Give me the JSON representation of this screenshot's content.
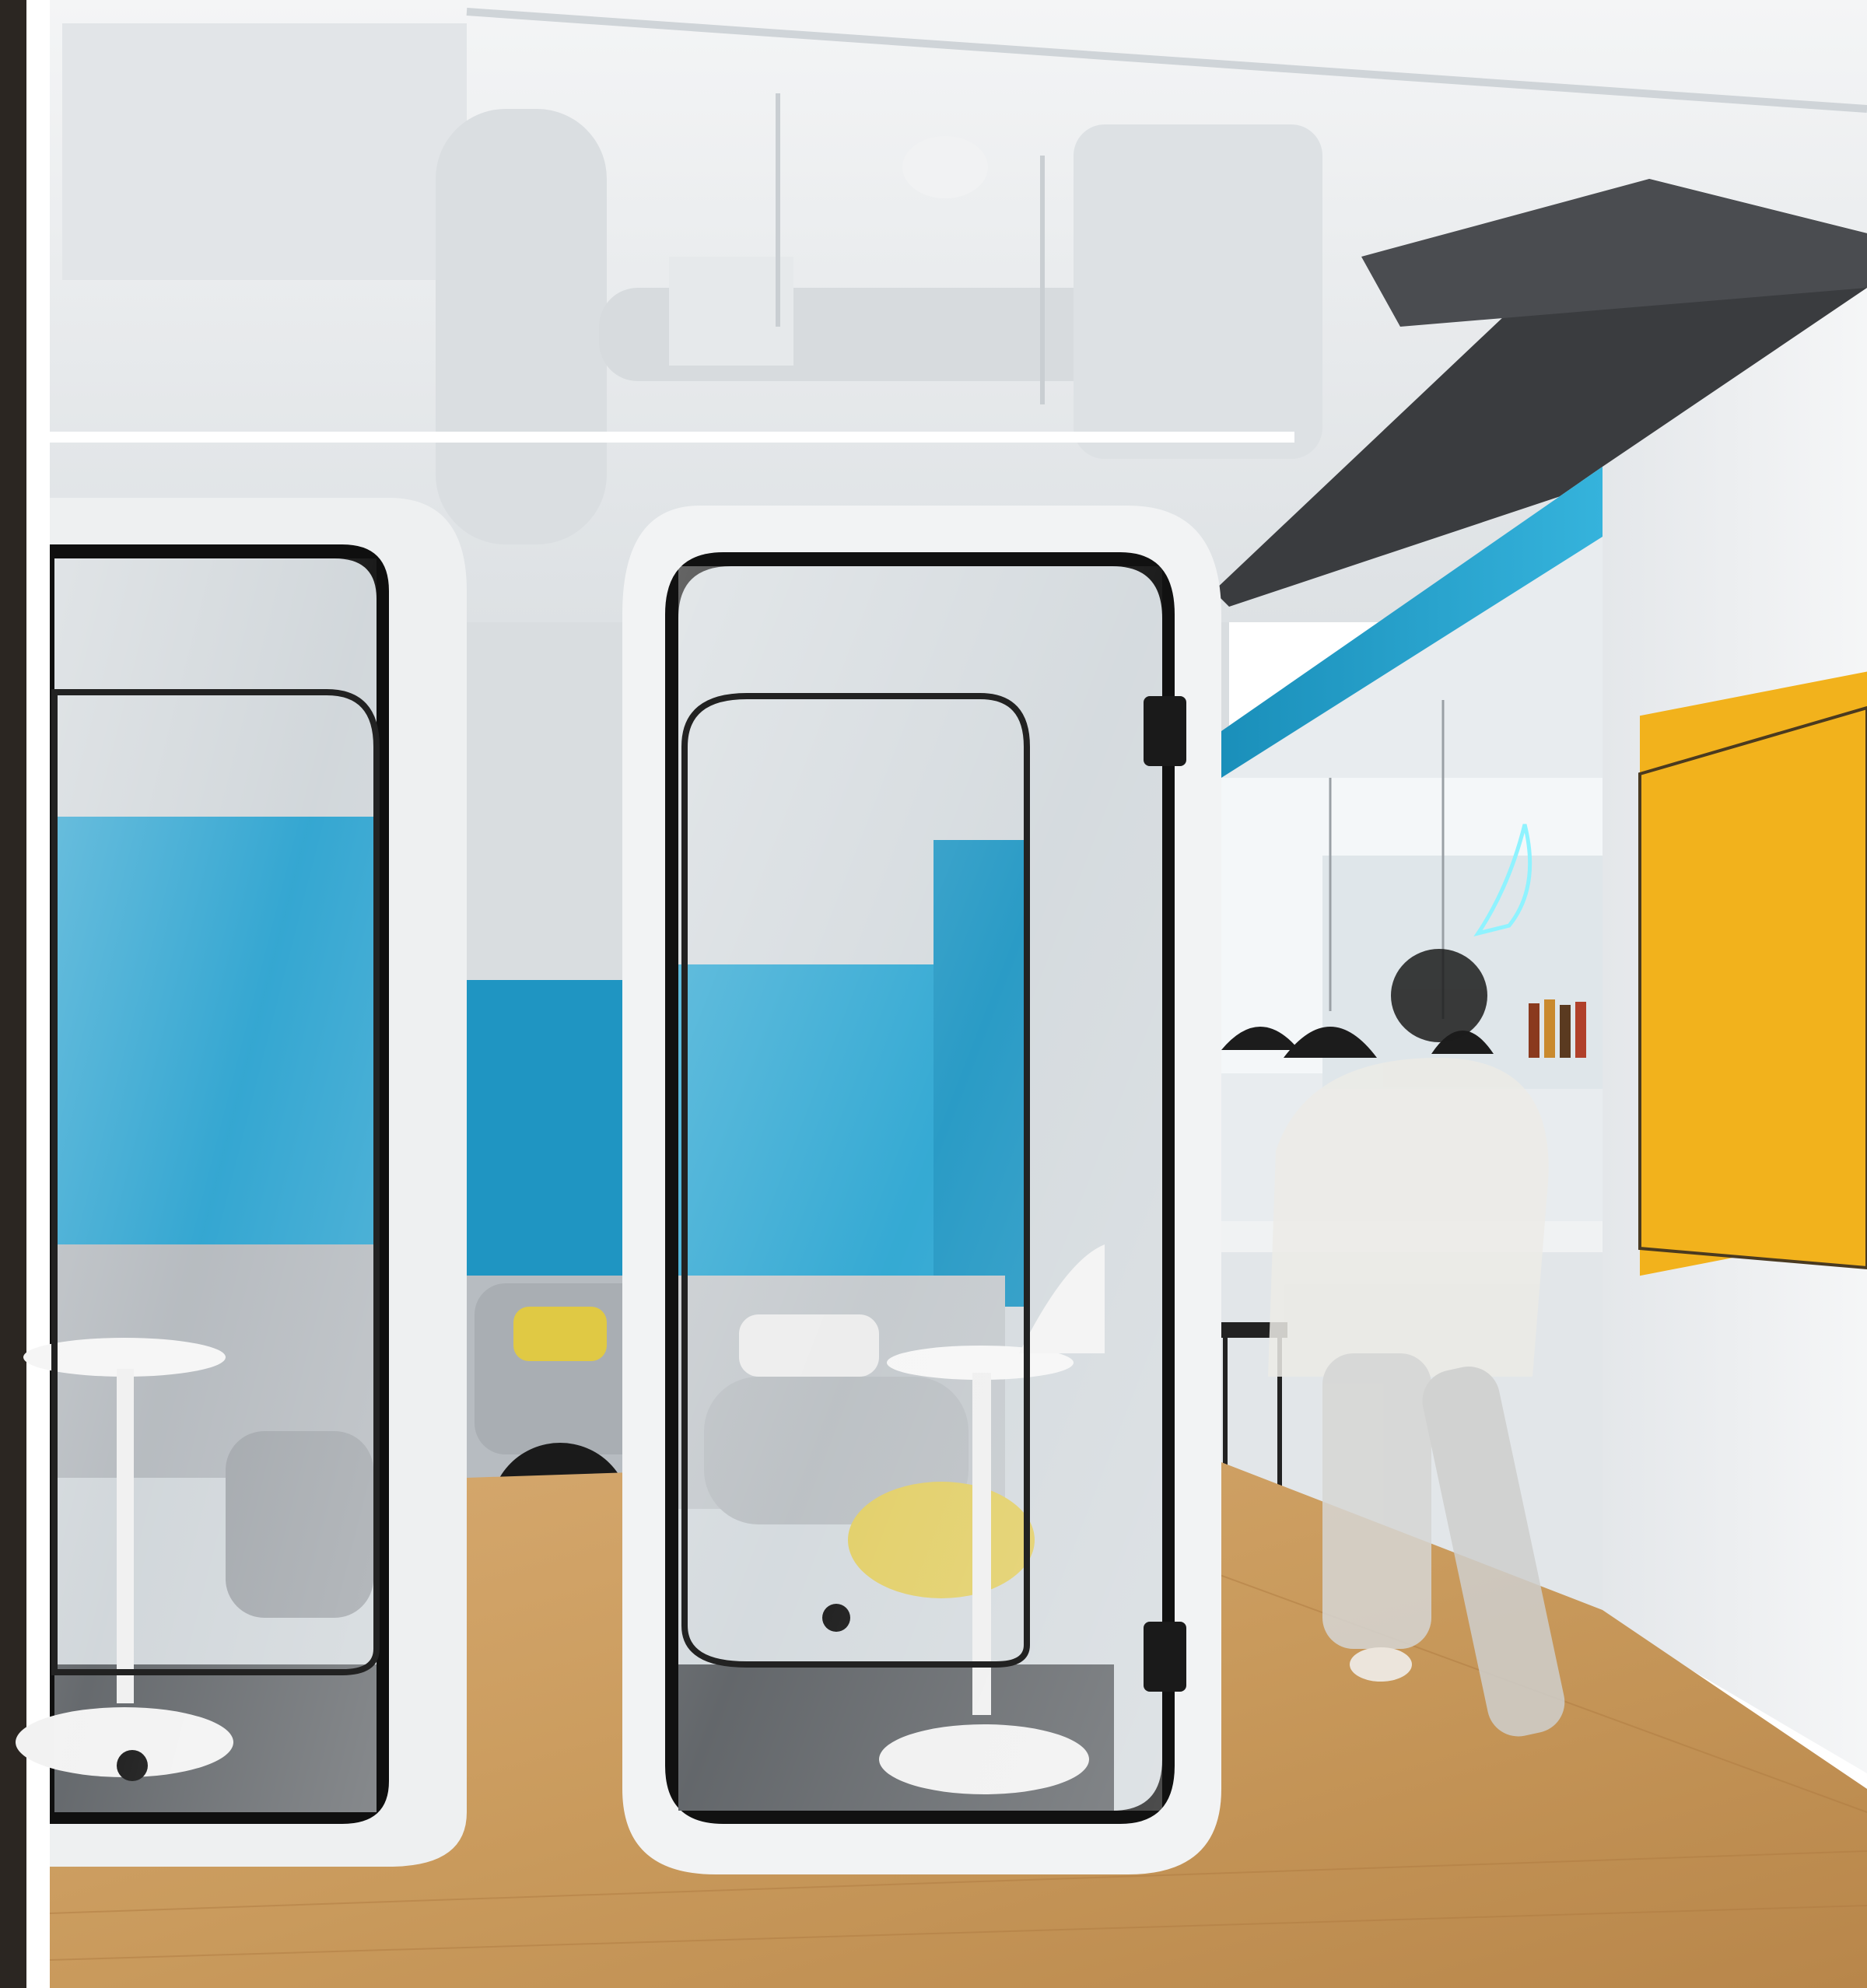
{
  "scene": {
    "subject": "office-interior-phone-booths",
    "colors": {
      "ceiling": "#e9ecee",
      "duct": "#dfe3e6",
      "floor": "#c99a5c",
      "booth_frame": "#f2f3f4",
      "booth_trim": "#111111",
      "accent_blue": "#1e9ec9",
      "yellow_panel": "#f2b21c",
      "left_strip": "#2b2622"
    }
  }
}
